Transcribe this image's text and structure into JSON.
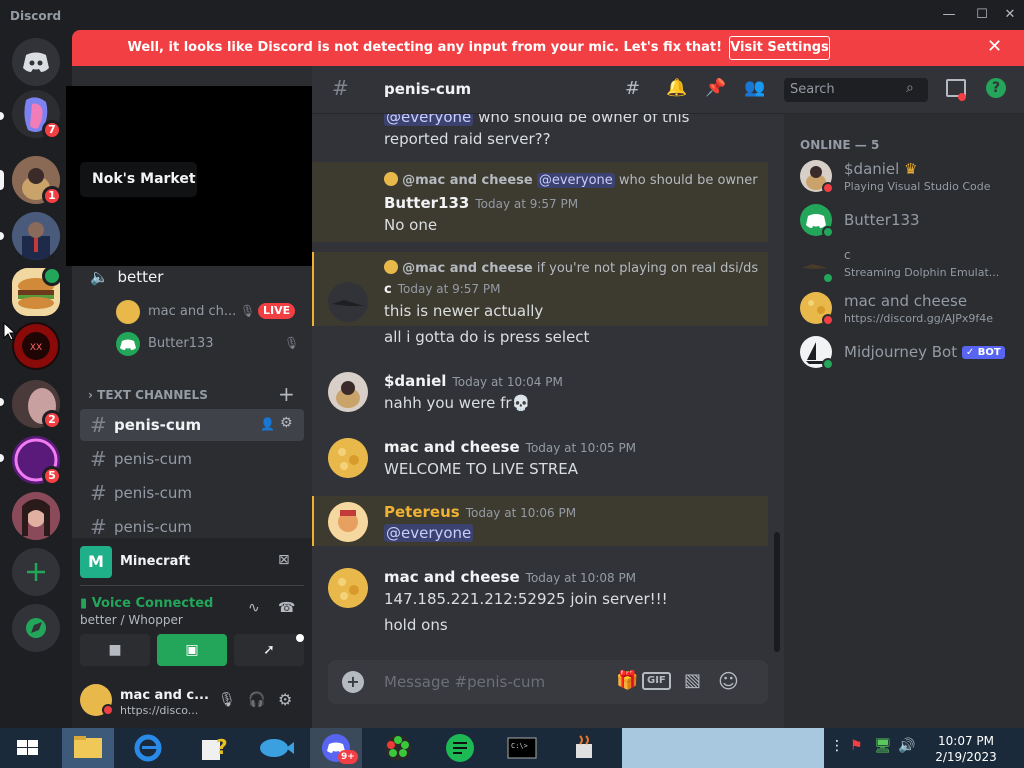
{
  "app": {
    "title": "Discord"
  },
  "banner": {
    "text": "Well, it looks like Discord is not detecting any input from your mic. Let's fix that!",
    "button": "Visit Settings"
  },
  "rail": {
    "badges": [
      "7",
      "1",
      "2",
      "5"
    ]
  },
  "tooltip": {
    "text": "Nok's Market"
  },
  "voice_channel": {
    "name": "better",
    "users": [
      {
        "name": "mac and ch...",
        "live": "LIVE"
      },
      {
        "name": "Butter133"
      }
    ]
  },
  "text_channels": {
    "header": "TEXT CHANNELS",
    "items": [
      "penis-cum",
      "penis-cum",
      "penis-cum",
      "penis-cum"
    ]
  },
  "activity": {
    "name": "Minecraft"
  },
  "voice_status": {
    "label": "Voice Connected",
    "sub": "better / Whopper"
  },
  "user_panel": {
    "name": "mac and c...",
    "sub": "https://disco..."
  },
  "channel": {
    "name": "penis-cum",
    "search_placeholder": "Search",
    "composer_placeholder": "Message #penis-cum"
  },
  "messages": [
    {
      "mention": "@everyone",
      "text": "who should be owner of this"
    },
    {
      "text": "reported raid server??"
    },
    {
      "reply_author": "@mac and cheese",
      "reply_mention": "@everyone",
      "reply_text": "who should be owner"
    },
    {
      "author": "Butter133",
      "time": "Today at 9:57 PM",
      "text": "No one"
    },
    {
      "reply_author": "@mac and cheese",
      "reply_text": "if you're not playing on real dsi/ds"
    },
    {
      "author": "c",
      "time": "Today at 9:57 PM",
      "text": "this is newer actually"
    },
    {
      "text": "all i gotta do is press select"
    },
    {
      "author": "$daniel",
      "time": "Today at 10:04 PM",
      "text": "nahh you were fr💀"
    },
    {
      "author": "mac and cheese",
      "time": "Today at 10:05 PM",
      "text": "WELCOME TO LIVE STREA"
    },
    {
      "author": "Petereus",
      "time": "Today at 10:06 PM",
      "mention": "@everyone"
    },
    {
      "author": "mac and cheese",
      "time": "Today at 10:08 PM",
      "text": "147.185.221.212:52925 join server!!!"
    },
    {
      "text": "hold ons"
    }
  ],
  "members": {
    "header": "ONLINE — 5",
    "list": [
      {
        "name": "$daniel",
        "sub": "Playing Visual Studio Code"
      },
      {
        "name": "Butter133"
      },
      {
        "name": "c",
        "sub": "Streaming Dolphin Emulat..."
      },
      {
        "name": "mac and cheese",
        "sub": "https://discord.gg/AJPx9f4e"
      },
      {
        "name": "Midjourney Bot",
        "tag": "✓ BOT"
      }
    ]
  },
  "taskbar": {
    "time": "10:07 PM",
    "date": "2/19/2023",
    "discord_badge": "9+"
  },
  "colors": {
    "blurple": "#5865f2",
    "red": "#f23f43",
    "green": "#23a55a",
    "bg": "#313338"
  }
}
